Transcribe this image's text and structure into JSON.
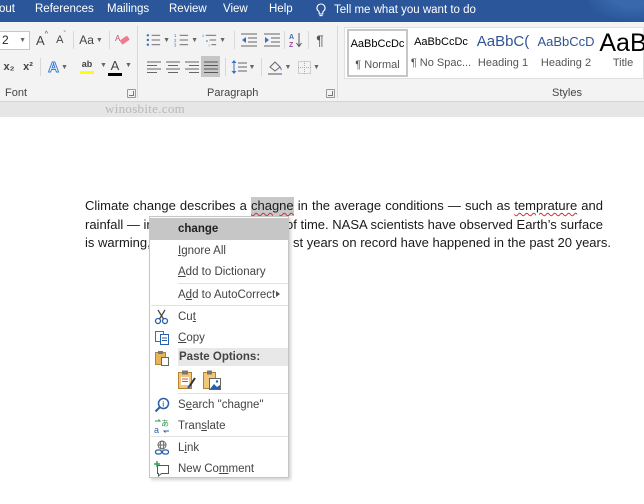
{
  "tabbar": {
    "tabs": [
      {
        "label": "out"
      },
      {
        "label": "References"
      },
      {
        "label": "Mailings"
      },
      {
        "label": "Review"
      },
      {
        "label": "View"
      },
      {
        "label": "Help"
      }
    ],
    "tell_me": "Tell me what you want to do",
    "tell_me_icon": "lightbulb-icon",
    "accent_color": "#2b579a"
  },
  "ribbon": {
    "font_group": {
      "label": "Font",
      "font_size_value": "2",
      "grow_font": "A",
      "shrink_font": "A",
      "change_case": "Aa",
      "subscript": "x₂",
      "superscript": "x²",
      "text_effects": "A",
      "highlight": "ab",
      "font_color": "A",
      "highlight_color": "#ffff00",
      "font_color_value": "#000000"
    },
    "paragraph_group": {
      "label": "Paragraph",
      "justify_active": true
    },
    "styles_group": {
      "label": "Styles",
      "items": [
        {
          "sample": "AaBbCcDc",
          "name": "¶ Normal",
          "selected": true
        },
        {
          "sample": "AaBbCcDc",
          "name": "¶ No Spac...",
          "selected": false
        },
        {
          "sample": "AaBbC(",
          "name": "Heading 1",
          "selected": false
        },
        {
          "sample": "AaBbCcD",
          "name": "Heading 2",
          "selected": false
        },
        {
          "sample": "AaB",
          "name": "Title",
          "selected": false
        }
      ]
    }
  },
  "watermark": "winosbite.com",
  "document": {
    "line1": [
      "Climate",
      "change",
      "describes",
      "a",
      "chagne",
      "in",
      "the",
      "average",
      "conditions",
      "—",
      "such",
      "as",
      "temprature",
      "and"
    ],
    "line2_left": "rainfall — ir",
    "line2_right": "od of time. NASA scientists have observed Earth’s surface",
    "line3_left": "is warming,",
    "line3_right": "st years on record have happened in the past 20 years.",
    "misspelled_words": [
      "chagne",
      "temprature"
    ],
    "selected_word": "chagne"
  },
  "context_menu": {
    "suggestion": "change",
    "ignore_all": {
      "pre": "",
      "key": "I",
      "post": "gnore All"
    },
    "add_to_dictionary": {
      "pre": "",
      "key": "A",
      "post": "dd to Dictionary"
    },
    "add_to_autocorrect": {
      "pre": "A",
      "key": "d",
      "post": "d to AutoCorrect"
    },
    "cut": {
      "pre": "Cu",
      "key": "t",
      "post": ""
    },
    "copy": {
      "pre": "",
      "key": "C",
      "post": "opy"
    },
    "paste_options": "Paste Options:",
    "paste_buttons": [
      "keep-source-formatting",
      "picture"
    ],
    "search": {
      "pre": "S",
      "key": "e",
      "post": "arch \"chagne\""
    },
    "translate": {
      "pre": "Tran",
      "key": "s",
      "post": "late"
    },
    "link": {
      "pre": "L",
      "key": "i",
      "post": "nk"
    },
    "new_comment": {
      "pre": "New Co",
      "key": "m",
      "post": "ment"
    }
  }
}
